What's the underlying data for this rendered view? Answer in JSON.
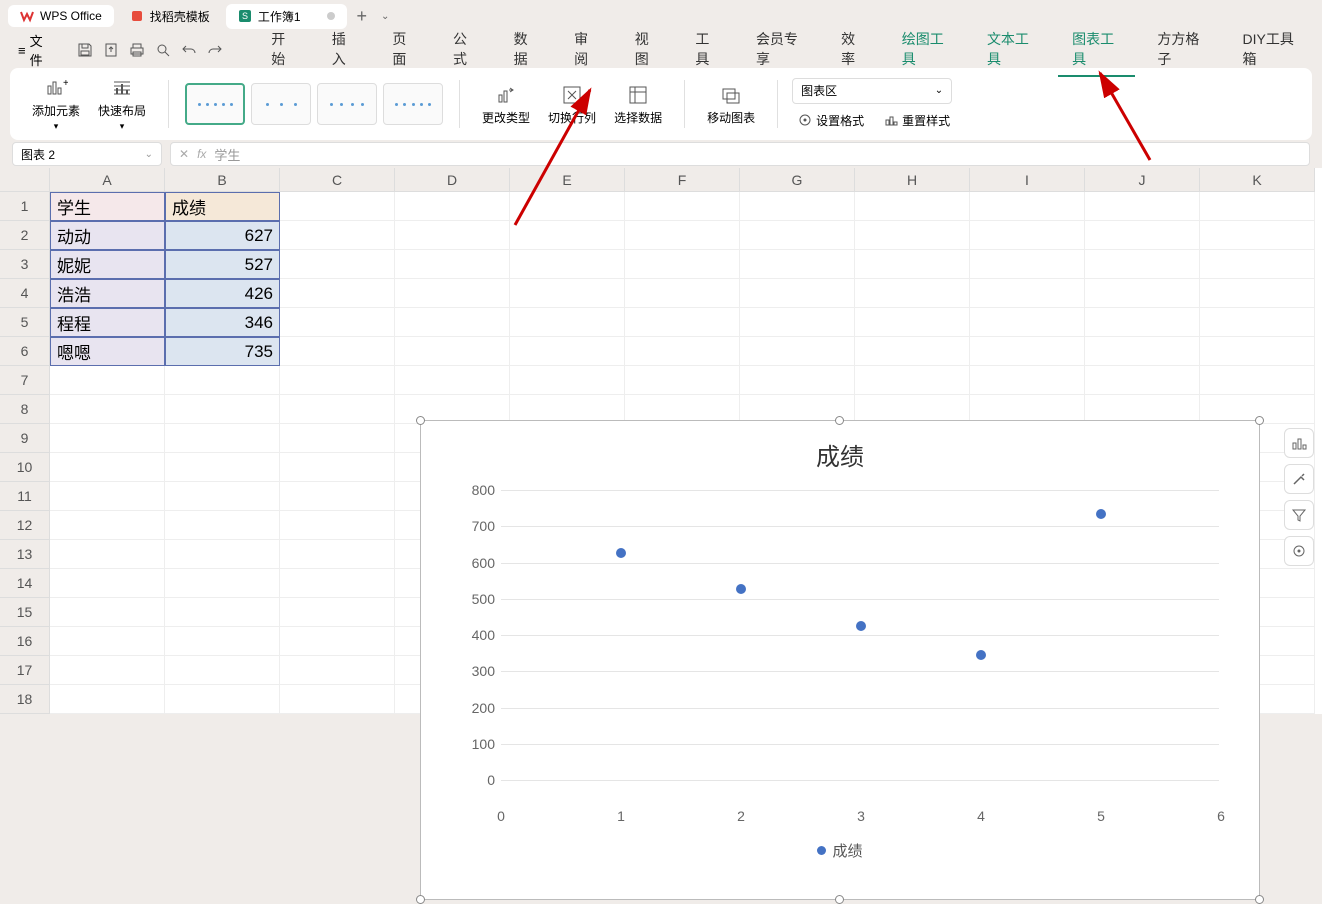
{
  "tabs": {
    "app": "WPS Office",
    "template": "找稻壳模板",
    "workbook": "工作簿1"
  },
  "menubar": {
    "file": "文件",
    "items": [
      "开始",
      "插入",
      "页面",
      "公式",
      "数据",
      "审阅",
      "视图",
      "工具",
      "会员专享",
      "效率"
    ],
    "context": [
      "绘图工具",
      "文本工具",
      "图表工具",
      "方方格子",
      "DIY工具箱"
    ],
    "active_context": 2
  },
  "ribbon": {
    "add_element": "添加元素",
    "quick_layout": "快速布局",
    "change_type": "更改类型",
    "switch_rc": "切换行列",
    "select_data": "选择数据",
    "move_chart": "移动图表",
    "chart_area_label": "图表区",
    "set_format": "设置格式",
    "reset_style": "重置样式"
  },
  "formula_bar": {
    "name_box": "图表 2",
    "fx_value": "学生"
  },
  "columns": [
    "A",
    "B",
    "C",
    "D",
    "E",
    "F",
    "G",
    "H",
    "I",
    "J",
    "K"
  ],
  "rows": [
    "1",
    "2",
    "3",
    "4",
    "5",
    "6",
    "7",
    "8",
    "9",
    "10",
    "11",
    "12",
    "13",
    "14",
    "15",
    "16",
    "17",
    "18"
  ],
  "table": {
    "headers": [
      "学生",
      "成绩"
    ],
    "data": [
      {
        "name": "动动",
        "score": 627
      },
      {
        "name": "妮妮",
        "score": 527
      },
      {
        "name": "浩浩",
        "score": 426
      },
      {
        "name": "程程",
        "score": 346
      },
      {
        "name": "嗯嗯",
        "score": 735
      }
    ]
  },
  "chart_data": {
    "type": "scatter",
    "title": "成绩",
    "xlabel": "",
    "ylabel": "",
    "x": [
      1,
      2,
      3,
      4,
      5
    ],
    "series": [
      {
        "name": "成绩",
        "values": [
          627,
          527,
          426,
          346,
          735
        ]
      }
    ],
    "xlim": [
      0,
      6
    ],
    "ylim": [
      0,
      800
    ],
    "y_ticks": [
      0,
      100,
      200,
      300,
      400,
      500,
      600,
      700,
      800
    ],
    "x_ticks": [
      0,
      1,
      2,
      3,
      4,
      5,
      6
    ],
    "legend": "成绩"
  }
}
